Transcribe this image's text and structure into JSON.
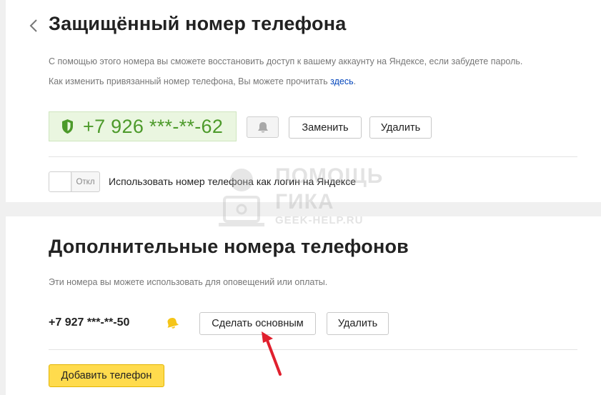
{
  "colors": {
    "accent_yellow": "#ffdb4d",
    "phone_green": "#4c9a2a",
    "link_blue": "#0044bb",
    "arrow_red": "#e0202e"
  },
  "main": {
    "back_icon": "chevron-left-icon",
    "title": "Защищённый номер телефона",
    "description_1": "С помощью этого номера вы сможете восстановить доступ к вашему аккаунту на Яндексе, если забудете пароль.",
    "description_2_prefix": "Как изменить привязанный номер телефона, Вы можете прочитать ",
    "description_2_link": "здесь",
    "description_2_suffix": ".",
    "phone_icon": "shield-icon",
    "phone": "+7 926 ***-**-62",
    "notify_icon": "bell-icon",
    "replace_label": "Заменить",
    "delete_label": "Удалить",
    "toggle_state": "Откл",
    "toggle_text": "Использовать номер телефона как логин на Яндексе"
  },
  "extra": {
    "title": "Дополнительные номера телефонов",
    "description": "Эти номера вы можете использовать для оповещений или оплаты.",
    "phone": "+7 927 ***-**-50",
    "notify_icon": "bell-icon",
    "make_main_label": "Сделать основным",
    "delete_label": "Удалить",
    "add_label": "Добавить телефон"
  },
  "watermark": {
    "line1": "ПОМОЩЬ",
    "line2": "ГИКА",
    "line3": "GEEK-HELP.RU"
  }
}
